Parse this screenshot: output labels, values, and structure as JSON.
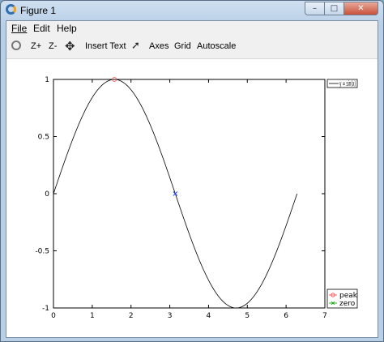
{
  "window": {
    "title": "Figure 1",
    "min_glyph": "–",
    "max_glyph": "□",
    "close_glyph": "✕"
  },
  "menu": {
    "file": "File",
    "edit": "Edit",
    "help": "Help"
  },
  "toolbar": {
    "zoom_in": "Z+",
    "zoom_out": "Z-",
    "insert_text": "Insert Text",
    "axes": "Axes",
    "grid": "Grid",
    "autoscale": "Autoscale"
  },
  "chart_data": {
    "type": "line",
    "title": "",
    "xlabel": "",
    "ylabel": "",
    "xlim": [
      0,
      7
    ],
    "ylim": [
      -1,
      1
    ],
    "xticks": [
      "0",
      "1",
      "2",
      "3",
      "4",
      "5",
      "6",
      "7"
    ],
    "yticks": [
      "1",
      "0.5",
      "0",
      "-0.5",
      "-1"
    ],
    "grid": false,
    "series": [
      {
        "name": "y = sin(x)",
        "function": "sin",
        "x_range": [
          0,
          6.283
        ],
        "color": "#000000"
      },
      {
        "name": "peak",
        "marker": "circle",
        "color": "#ff4040",
        "x": [
          1.5708
        ],
        "y": [
          1
        ]
      },
      {
        "name": "zero",
        "marker": "cross",
        "color": "#00a000",
        "x": [
          3.1416
        ],
        "y": [
          0
        ]
      }
    ],
    "point_colors_on_plot": {
      "peak": "#ff4040",
      "zero": "#2040ff"
    },
    "legend_placement": [
      "top-right, outside",
      "bottom-right, outside"
    ]
  }
}
